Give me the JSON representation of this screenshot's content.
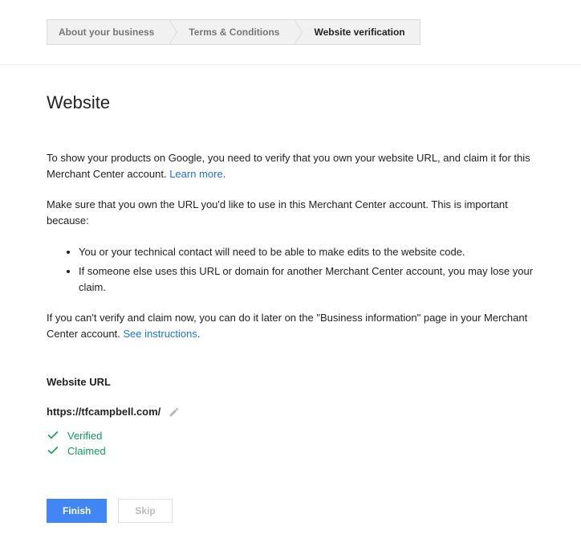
{
  "breadcrumb": {
    "items": [
      {
        "label": "About your business"
      },
      {
        "label": "Terms & Conditions"
      },
      {
        "label": "Website verification"
      }
    ]
  },
  "heading": "Website",
  "intro": {
    "p1a": "To show your products on Google, you need to verify that you own your website URL, and claim it for this Merchant Center account. ",
    "learnMore": "Learn more",
    "p2": "Make sure that you own the URL you'd like to use in this Merchant Center account. This is important because:",
    "bullet1": "You or your technical contact will need to be able to make edits to the website code.",
    "bullet2": "If someone else uses this URL or domain for another Merchant Center account, you may lose your claim.",
    "p3a": "If you can't verify and claim now, you can do it later on the \"Business information\" page in your Merchant Center account. ",
    "seeInstructions": "See instructions"
  },
  "urlSection": {
    "label": "Website URL",
    "url": "https://tfcampbell.com/",
    "status1": "Verified",
    "status2": "Claimed"
  },
  "actions": {
    "finish": "Finish",
    "skip": "Skip"
  }
}
